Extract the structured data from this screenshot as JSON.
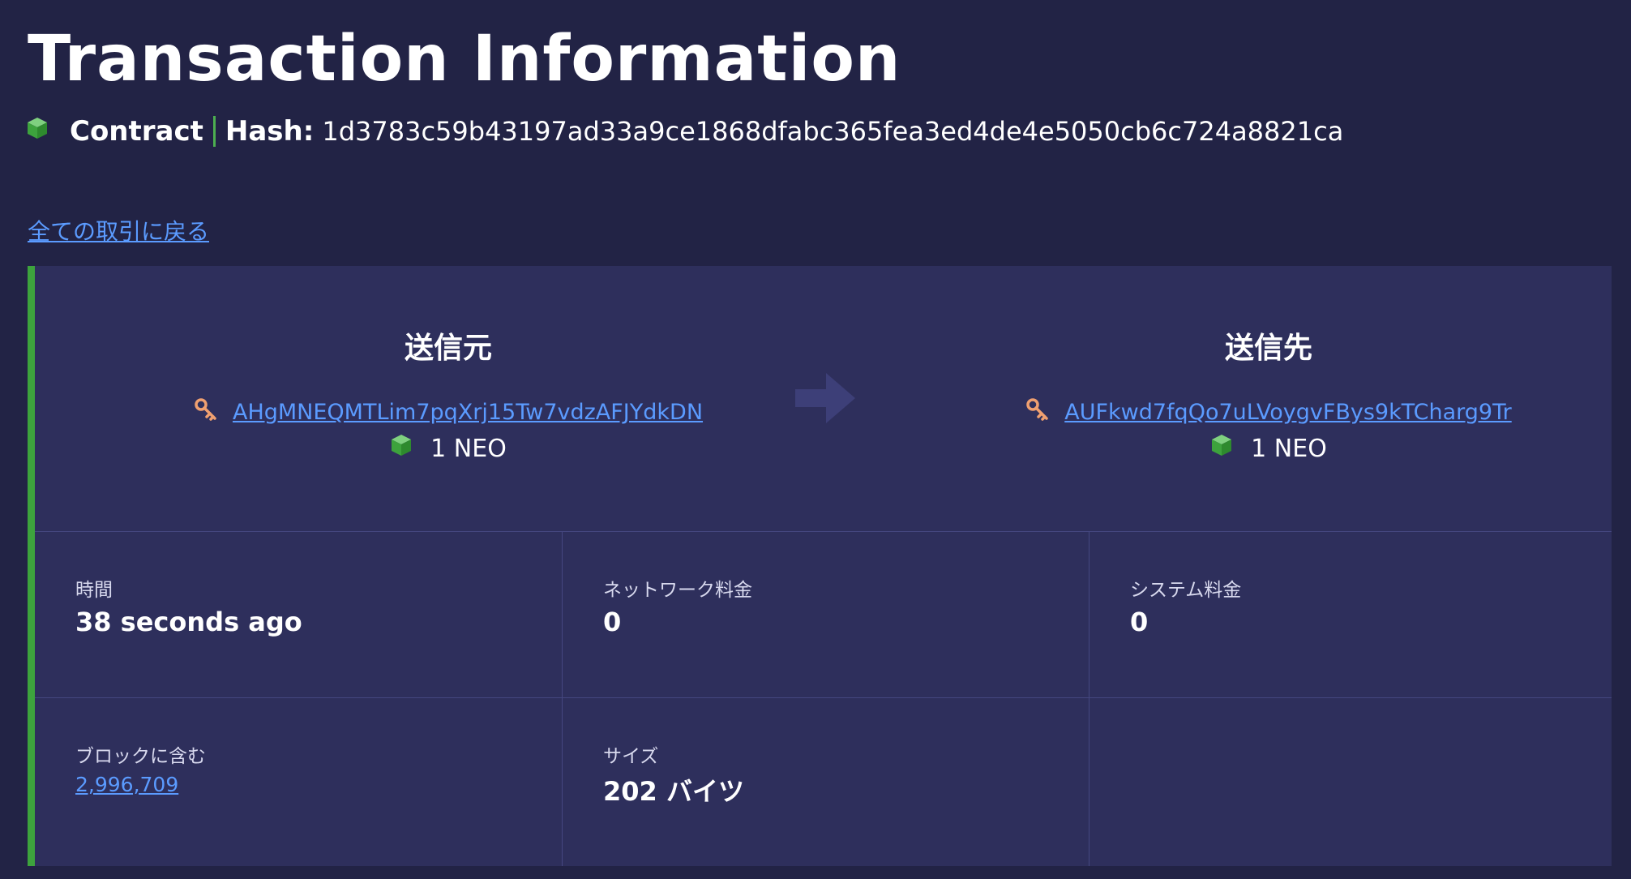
{
  "header": {
    "title": "Transaction Information",
    "type_label": "Contract",
    "hash_label": "Hash:",
    "hash_value": "1d3783c59b43197ad33a9ce1868dfabc365fea3ed4de4e5050cb6c724a8821ca"
  },
  "back_link": "全ての取引に戻る",
  "transfer": {
    "from": {
      "title": "送信元",
      "address": "AHgMNEQMTLim7pqXrj15Tw7vdzAFJYdkDN",
      "amount": "1 NEO"
    },
    "to": {
      "title": "送信先",
      "address": "AUFkwd7fqQo7uLVoygvFBys9kTCharg9Tr",
      "amount": "1 NEO"
    }
  },
  "details": {
    "time": {
      "label": "時間",
      "value": "38 seconds ago"
    },
    "network_fee": {
      "label": "ネットワーク料金",
      "value": "0"
    },
    "system_fee": {
      "label": "システム料金",
      "value": "0"
    },
    "block": {
      "label": "ブロックに含む",
      "value": "2,996,709"
    },
    "size": {
      "label": "サイズ",
      "value": "202 バイツ"
    }
  },
  "colors": {
    "background": "#222345",
    "card": "#2e2f5c",
    "accent_green": "#3da33d",
    "link_blue": "#5b9bff",
    "key_orange": "#f0a070"
  },
  "icons": {
    "asset": "cube-icon",
    "address": "key-icon",
    "direction": "arrow-right-icon"
  }
}
